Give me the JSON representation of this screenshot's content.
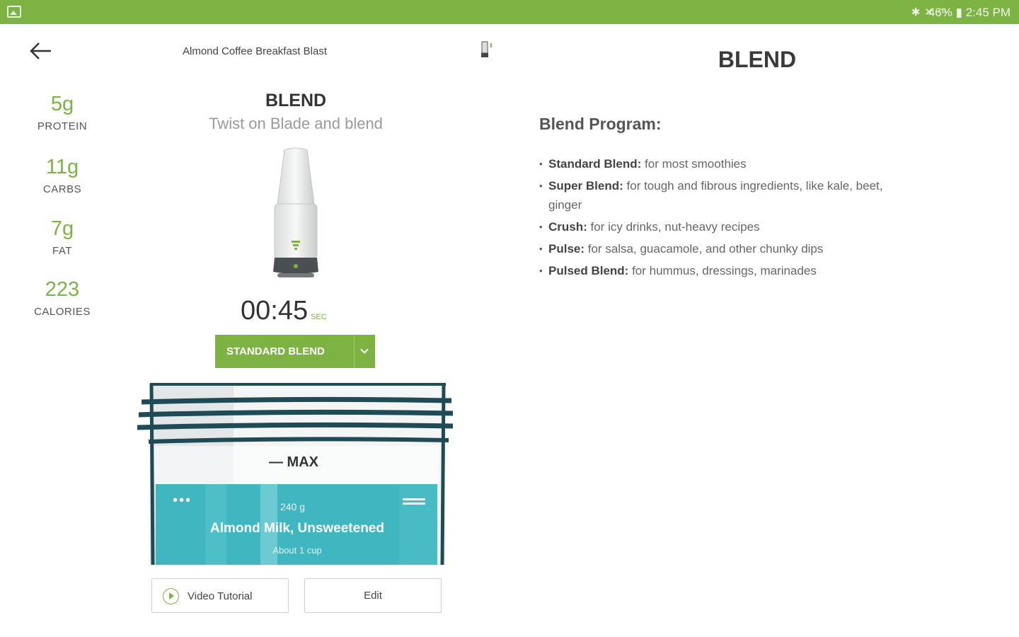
{
  "status_bar": {
    "battery": "46%",
    "time": "2:45 PM",
    "icons": [
      "bluetooth-icon",
      "mute-icon",
      "wifi-icon",
      "battery-icon"
    ]
  },
  "header": {
    "recipe_title": "Almond Coffee Breakfast Blast"
  },
  "nutrition": [
    {
      "value": "5g",
      "label": "PROTEIN"
    },
    {
      "value": "11g",
      "label": "CARBS"
    },
    {
      "value": "7g",
      "label": "FAT"
    },
    {
      "value": "223",
      "label": "CALORIES"
    }
  ],
  "step": {
    "title": "BLEND",
    "subtitle": "Twist on Blade and blend",
    "time": "00:45",
    "time_unit": "SEC",
    "program": "STANDARD BLEND"
  },
  "cup": {
    "max_label": "— MAX",
    "ingredient": {
      "weight": "240 g",
      "name": "Almond Milk, Unsweetened",
      "quantity": "About 1 cup"
    }
  },
  "buttons": {
    "video": "Video Tutorial",
    "edit": "Edit"
  },
  "panel": {
    "title": "BLEND",
    "heading": "Blend Program:",
    "items": [
      {
        "term": "Standard Blend:",
        "desc": " for most smoothies"
      },
      {
        "term": "Super Blend:",
        "desc": " for tough and fibrous ingredients, like kale, beet, ginger"
      },
      {
        "term": "Crush:",
        "desc": " for icy drinks, nut-heavy recipes"
      },
      {
        "term": "Pulse:",
        "desc": " for salsa, guacamole, and other chunky dips"
      },
      {
        "term": "Pulsed Blend:",
        "desc": " for hummus, dressings, marinades"
      }
    ]
  },
  "colors": {
    "accent": "#7cb342",
    "teal": "#3fb6c0",
    "dark_teal": "#1f4b57"
  }
}
